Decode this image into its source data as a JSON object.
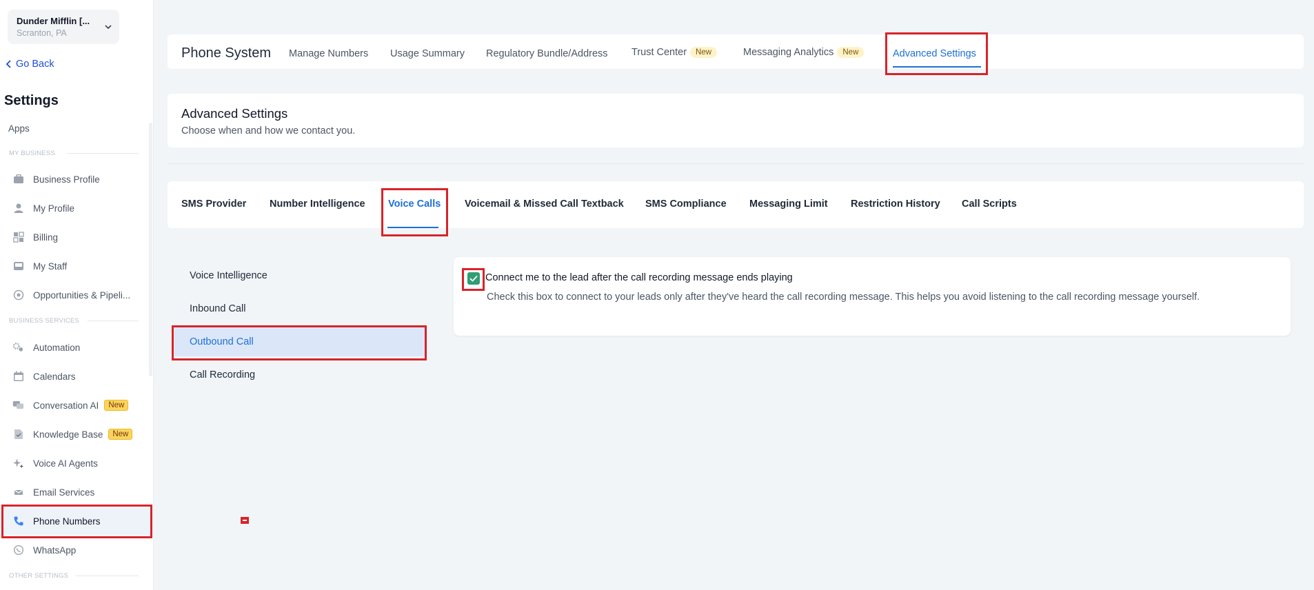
{
  "account": {
    "name": "Dunder Mifflin [...",
    "location": "Scranton, PA"
  },
  "sidebar": {
    "go_back": "Go Back",
    "title": "Settings",
    "apps": "Apps",
    "sections": {
      "my_business": "MY BUSINESS",
      "business_services": "BUSINESS SERVICES",
      "other_settings": "OTHER SETTINGS"
    },
    "items": [
      {
        "label": "Business Profile",
        "icon": "briefcase-icon"
      },
      {
        "label": "My Profile",
        "icon": "user-icon"
      },
      {
        "label": "Billing",
        "icon": "grid-icon"
      },
      {
        "label": "My Staff",
        "icon": "inbox-icon"
      },
      {
        "label": "Opportunities & Pipeli...",
        "icon": "target-icon"
      },
      {
        "label": "Automation",
        "icon": "gears-icon"
      },
      {
        "label": "Calendars",
        "icon": "calendar-icon"
      },
      {
        "label": "Conversation AI",
        "icon": "chat-icon",
        "badge": "New"
      },
      {
        "label": "Knowledge Base",
        "icon": "document-icon",
        "badge": "New"
      },
      {
        "label": "Voice AI Agents",
        "icon": "sparkle-icon"
      },
      {
        "label": "Email Services",
        "icon": "mail-icon"
      },
      {
        "label": "Phone Numbers",
        "icon": "phone-icon"
      },
      {
        "label": "WhatsApp",
        "icon": "whatsapp-icon"
      }
    ]
  },
  "topbar": {
    "title": "Phone System",
    "tabs": [
      {
        "label": "Manage Numbers"
      },
      {
        "label": "Usage Summary"
      },
      {
        "label": "Regulatory Bundle/Address"
      },
      {
        "label": "Trust Center",
        "badge": "New"
      },
      {
        "label": "Messaging Analytics",
        "badge": "New"
      },
      {
        "label": "Advanced Settings"
      }
    ]
  },
  "header": {
    "title": "Advanced Settings",
    "subtitle": "Choose when and how we contact you."
  },
  "subtabs": [
    "SMS Provider",
    "Number Intelligence",
    "Voice Calls",
    "Voicemail & Missed Call Textback",
    "SMS Compliance",
    "Messaging Limit",
    "Restriction History",
    "Call Scripts"
  ],
  "submenu": [
    "Voice Intelligence",
    "Inbound Call",
    "Outbound Call",
    "Call Recording"
  ],
  "content": {
    "checkbox_label": "Connect me to the lead after the call recording message ends playing",
    "checkbox_checked": true,
    "description": "Check this box to connect to your leads only after they've heard the call recording message. This helps you avoid listening to the call recording message yourself."
  },
  "colors": {
    "accent": "#1d6fd6",
    "highlight": "#d8232a",
    "checkbox": "#2f9e74"
  }
}
